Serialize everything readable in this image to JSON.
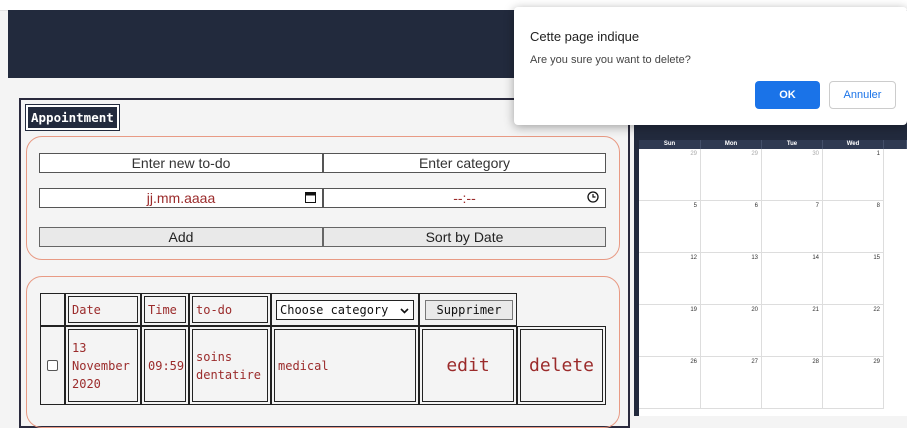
{
  "app": {
    "label": "Appointment",
    "form": {
      "todo_placeholder": "Enter new to-do",
      "category_placeholder": "Enter category",
      "date_placeholder": "jj.mm.aaaa",
      "time_placeholder": "--:--",
      "add_label": "Add",
      "sort_label": "Sort by Date"
    },
    "table": {
      "headers": {
        "date": "Date",
        "time": "Time",
        "todo": "to-do"
      },
      "category_select": "Choose category",
      "supprimer_label": "Supprimer",
      "row": {
        "date": "13 November 2020",
        "time": "09:59",
        "todo": "soins dentatire",
        "category": "medical",
        "edit": "edit",
        "delete": "delete"
      }
    }
  },
  "calendar": {
    "days": [
      "Sun",
      "Mon",
      "Tue",
      "Wed"
    ],
    "weeks": [
      [
        "29",
        "29",
        "30",
        "1"
      ],
      [
        "5",
        "6",
        "7",
        "8"
      ],
      [
        "12",
        "13",
        "14",
        "15"
      ],
      [
        "19",
        "20",
        "21",
        "22"
      ],
      [
        "26",
        "27",
        "28",
        "29"
      ]
    ]
  },
  "dialog": {
    "title": "Cette page indique",
    "message": "Are you sure you want to delete?",
    "ok_label": "OK",
    "cancel_label": "Annuler"
  },
  "colors": {
    "header": "#222a3d",
    "accent_border": "#e89a84",
    "text_red": "#9b2b2b",
    "primary": "#1a73e8"
  },
  "icons": [
    "calendar-icon",
    "clock-icon",
    "chevron-down-icon"
  ]
}
